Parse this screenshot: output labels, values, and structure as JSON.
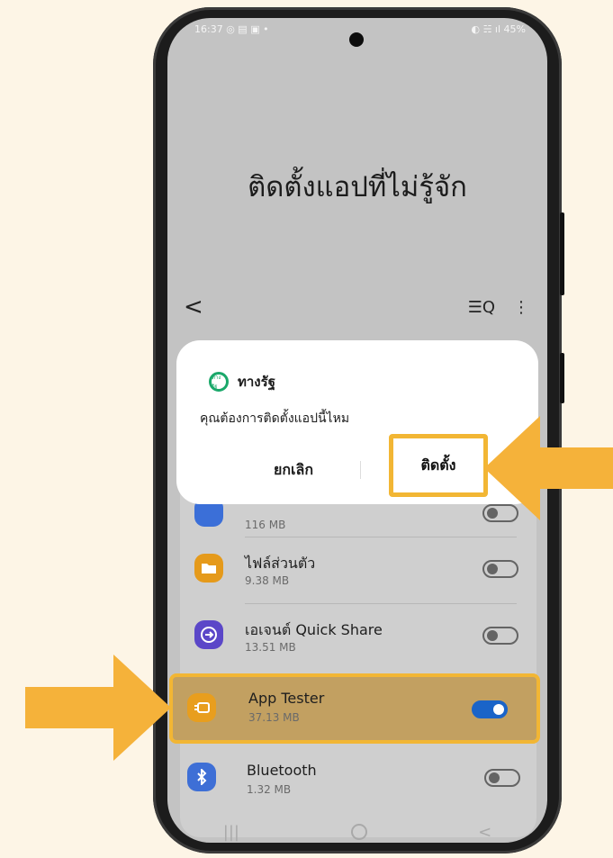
{
  "status_bar": {
    "time": "16:37",
    "left_icons": "◎ ▤ ▣ •",
    "right_icons": "◐ ☵ ıl",
    "battery": "45%"
  },
  "screen": {
    "title": "ติดตั้งแอปที่ไม่รู้จัก"
  },
  "appbar": {
    "back_icon": "<",
    "search_icon": "☰Q",
    "more_icon": "⋮"
  },
  "dialog": {
    "app_name": "ทางรัฐ",
    "logo_text": "ทางรัฐ",
    "question": "คุณต้องการติดตั้งแอปนี้ไหม",
    "cancel_label": "ยกเลิก",
    "install_label": "ติดตั้ง"
  },
  "apps": [
    {
      "name": "",
      "size": "116 MB",
      "icon": "generic-app-icon",
      "color": "#3b6fd8",
      "enabled": false
    },
    {
      "name": "ไฟล์ส่วนตัว",
      "size": "9.38 MB",
      "icon": "folder-icon",
      "color": "#e59a1b",
      "enabled": false
    },
    {
      "name": "เอเจนต์ Quick Share",
      "size": "13.51 MB",
      "icon": "quick-share-icon",
      "color": "#5b47c8",
      "enabled": false
    },
    {
      "name": "App Tester",
      "size": "37.13 MB",
      "icon": "app-tester-icon",
      "color": "#e89e1e",
      "enabled": true
    },
    {
      "name": "Bluetooth",
      "size": "1.32 MB",
      "icon": "bluetooth-icon",
      "color": "#3e6fd6",
      "enabled": false
    }
  ],
  "navbar": {
    "recents": "|||",
    "back": "<"
  },
  "colors": {
    "highlight": "#f2b634",
    "arrow": "#f5b23a",
    "toggle_on": "#1a64c8"
  }
}
